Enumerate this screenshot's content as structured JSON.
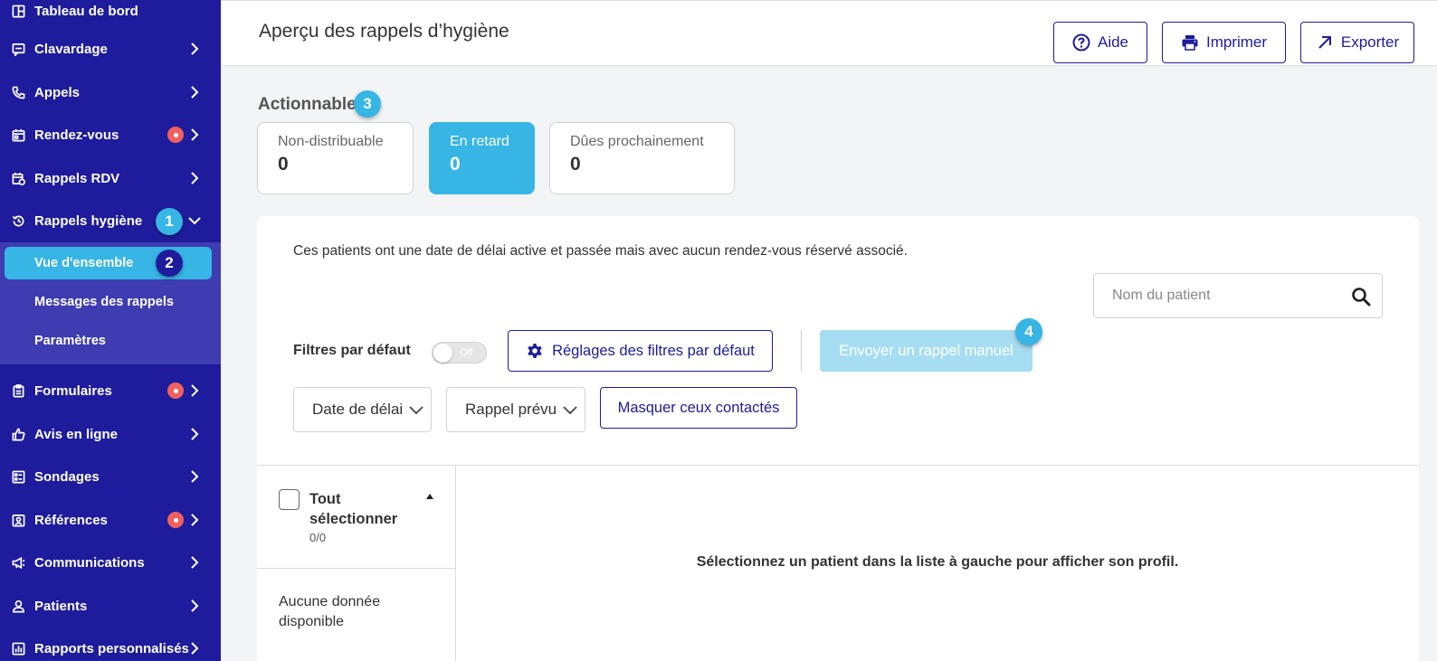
{
  "sidebar": {
    "items": [
      {
        "label": "Tableau de bord",
        "icon": "dashboard-icon"
      },
      {
        "label": "Clavardage",
        "icon": "chat-icon"
      },
      {
        "label": "Appels",
        "icon": "phone-icon"
      },
      {
        "label": "Rendez-vous",
        "icon": "calendar-icon"
      },
      {
        "label": "Rappels RDV",
        "icon": "calendar-reminder-icon"
      },
      {
        "label": "Rappels hygiène",
        "icon": "history-icon"
      },
      {
        "label": "Formulaires",
        "icon": "clipboard-icon"
      },
      {
        "label": "Avis en ligne",
        "icon": "thumbs-up-icon"
      },
      {
        "label": "Sondages",
        "icon": "survey-icon"
      },
      {
        "label": "Références",
        "icon": "referral-icon"
      },
      {
        "label": "Communications",
        "icon": "megaphone-icon"
      },
      {
        "label": "Patients",
        "icon": "user-icon"
      },
      {
        "label": "Rapports personnalisés",
        "icon": "report-icon"
      }
    ],
    "submenu": [
      {
        "label": "Vue d'ensemble"
      },
      {
        "label": "Messages des rappels"
      },
      {
        "label": "Paramètres"
      }
    ],
    "callouts": [
      "1",
      "2"
    ]
  },
  "header": {
    "title": "Aperçu des rappels d’hygiène",
    "help_label": "Aide",
    "print_label": "Imprimer",
    "export_label": "Exporter"
  },
  "actionable": {
    "label": "Actionnable",
    "callout": "3",
    "cards": [
      {
        "label": "Non-distribuable",
        "value": "0"
      },
      {
        "label": "En retard",
        "value": "0"
      },
      {
        "label": "Dûes prochainement",
        "value": "0"
      }
    ]
  },
  "panel": {
    "description": "Ces patients ont une date de délai active et passée mais avec aucun rendez-vous réservé associé.",
    "search_placeholder": "Nom du patient",
    "default_filters_label": "Filtres par défaut",
    "toggle_label": "Off",
    "filter_settings_label": "Réglages des filtres par défaut",
    "send_manual_label": "Envoyer un rappel manuel",
    "send_callout": "4",
    "dropdown_due_date": "Date de délai",
    "dropdown_planned": "Rappel prévu",
    "hide_contacted_label": "Masquer ceux contactés",
    "select_all_label": "Tout sélectionner",
    "select_count": "0/0",
    "no_data": "Aucune donnée disponible",
    "empty_profile_message": "Sélectionnez un patient dans la liste à gauche pour afficher son profil."
  },
  "colors": {
    "sidebar_bg": "#1e1c9c",
    "submenu_bg": "#3e3cb0",
    "accent": "#37b5e5",
    "alert_dot": "#f0605e"
  }
}
